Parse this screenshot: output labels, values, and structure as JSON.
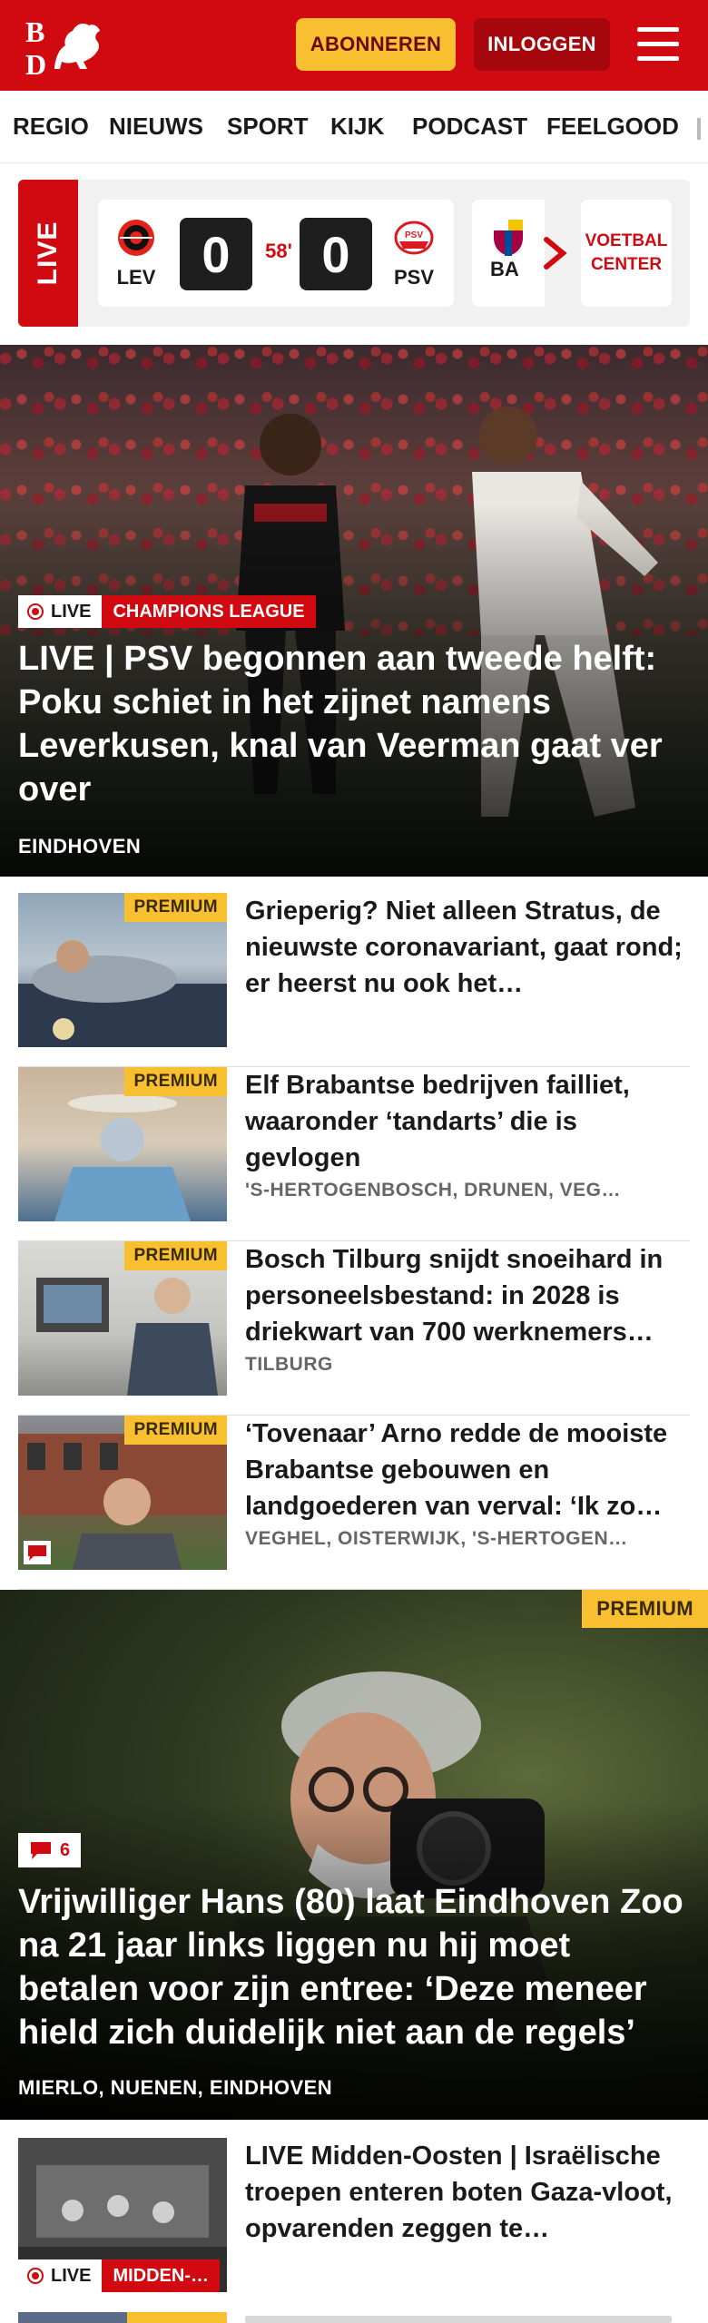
{
  "header": {
    "logo_text": "BD",
    "subscribe_label": "ABONNEREN",
    "login_label": "INLOGGEN",
    "menu_icon": "hamburger-menu-icon",
    "brand_color": "#d10a11",
    "accent_color": "#f8c031"
  },
  "nav": {
    "items": [
      "REGIO",
      "NIEUWS",
      "SPORT",
      "KIJK",
      "PODCAST",
      "FEELGOOD"
    ]
  },
  "live_scores": {
    "live_label": "LIVE",
    "match": {
      "home_code": "LEV",
      "home_score": "0",
      "minute": "58'",
      "away_score": "0",
      "away_code": "PSV"
    },
    "next_match_code": "BA",
    "voetbal_center_label": "VOETBAL CENTER"
  },
  "hero": {
    "live_label": "LIVE",
    "category": "CHAMPIONS LEAGUE",
    "title": "LIVE | PSV begonnen aan tweede helft: Poku schiet in het zijnet namens Leverkusen, knal van Veerman gaat ver over",
    "location": "EINDHOVEN"
  },
  "articles": [
    {
      "premium": "PREMIUM",
      "title": "Grieperig? Niet alleen Stratus, de nieuwste coronavariant, gaat rond; er heerst nu ook het…",
      "location": ""
    },
    {
      "premium": "PREMIUM",
      "title": "Elf Brabantse bedrijven failliet, waaronder ‘tandarts’ die is gevlogen",
      "location": "'S-HERTOGENBOSCH, DRUNEN, VEG…"
    },
    {
      "premium": "PREMIUM",
      "title": "Bosch Tilburg snijdt snoeihard in personeelsbestand: in 2028 is driekwart van 700 werknemers…",
      "location": "TILBURG"
    },
    {
      "premium": "PREMIUM",
      "title": "‘Tovenaar’ Arno redde de mooiste Brabantse gebouwen en landgoederen van verval: ‘Ik zo…",
      "location": "VEGHEL, OISTERWIJK, 'S-HERTOGEN…"
    }
  ],
  "big_article": {
    "premium": "PREMIUM",
    "comment_count": "6",
    "title": "Vrijwilliger Hans (80) laat Eindhoven Zoo na 21 jaar links liggen nu hij moet betalen voor zijn entree: ‘Deze meneer hield zich duidelijk niet aan de regels’",
    "location": "MIERLO, NUENEN, EINDHOVEN"
  },
  "live_article": {
    "live_label": "LIVE",
    "category": "MIDDEN-…",
    "title": "LIVE Midden-Oosten | Israëlische troepen enteren boten Gaza-vloot, opvarenden zeggen te…"
  }
}
